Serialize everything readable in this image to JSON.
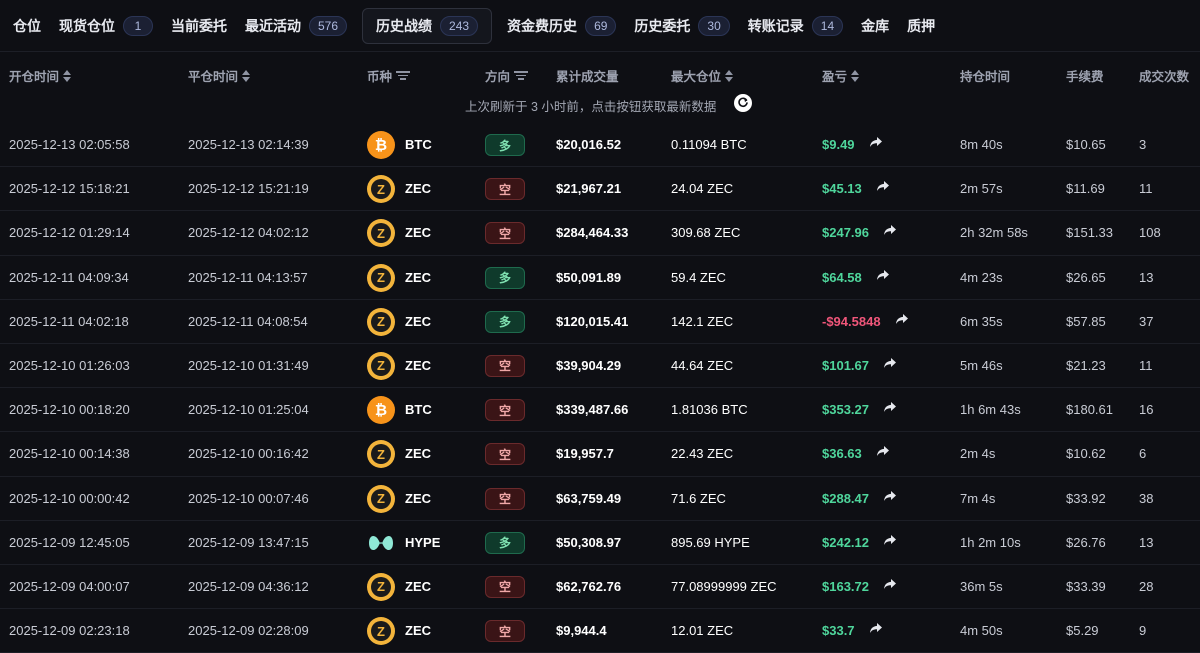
{
  "tabs": [
    {
      "label": "仓位",
      "badge": null,
      "active": false
    },
    {
      "label": "现货仓位",
      "badge": "1",
      "active": false
    },
    {
      "label": "当前委托",
      "badge": null,
      "active": false
    },
    {
      "label": "最近活动",
      "badge": "576",
      "active": false
    },
    {
      "label": "历史战绩",
      "badge": "243",
      "active": true
    },
    {
      "label": "资金费历史",
      "badge": "69",
      "active": false
    },
    {
      "label": "历史委托",
      "badge": "30",
      "active": false
    },
    {
      "label": "转账记录",
      "badge": "14",
      "active": false
    },
    {
      "label": "金库",
      "badge": null,
      "active": false
    },
    {
      "label": "质押",
      "badge": null,
      "active": false
    }
  ],
  "columns": {
    "open_time": "开仓时间",
    "close_time": "平仓时间",
    "coin": "币种",
    "direction": "方向",
    "volume": "累计成交量",
    "max_position": "最大仓位",
    "pnl": "盈亏",
    "duration": "持仓时间",
    "fee": "手续费",
    "trades": "成交次数"
  },
  "refresh_note": "上次刷新于 3 小时前，点击按钮获取最新数据",
  "colors": {
    "long": "#7fe0b0",
    "short": "#f0a8a8",
    "pnl_positive": "#4fd69c",
    "pnl_negative": "#f0567a",
    "btc": "#f7931a",
    "zec": "#f3b43b"
  },
  "rows": [
    {
      "open": "2025-12-13 02:05:58",
      "close": "2025-12-13 02:14:39",
      "coin": "BTC",
      "icon": "btc-icon",
      "dir": "多",
      "side": "long",
      "vol": "$20,016.52",
      "max": "0.11094 BTC",
      "pnl": "$9.49",
      "pnl_sign": "pos",
      "dur": "8m 40s",
      "fee": "$10.65",
      "trades": "3"
    },
    {
      "open": "2025-12-12 15:18:21",
      "close": "2025-12-12 15:21:19",
      "coin": "ZEC",
      "icon": "zec-icon",
      "dir": "空",
      "side": "short",
      "vol": "$21,967.21",
      "max": "24.04 ZEC",
      "pnl": "$45.13",
      "pnl_sign": "pos",
      "dur": "2m 57s",
      "fee": "$11.69",
      "trades": "11"
    },
    {
      "open": "2025-12-12 01:29:14",
      "close": "2025-12-12 04:02:12",
      "coin": "ZEC",
      "icon": "zec-icon",
      "dir": "空",
      "side": "short",
      "vol": "$284,464.33",
      "max": "309.68 ZEC",
      "pnl": "$247.96",
      "pnl_sign": "pos",
      "dur": "2h 32m 58s",
      "fee": "$151.33",
      "trades": "108"
    },
    {
      "open": "2025-12-11 04:09:34",
      "close": "2025-12-11 04:13:57",
      "coin": "ZEC",
      "icon": "zec-icon",
      "dir": "多",
      "side": "long",
      "vol": "$50,091.89",
      "max": "59.4 ZEC",
      "pnl": "$64.58",
      "pnl_sign": "pos",
      "dur": "4m 23s",
      "fee": "$26.65",
      "trades": "13"
    },
    {
      "open": "2025-12-11 04:02:18",
      "close": "2025-12-11 04:08:54",
      "coin": "ZEC",
      "icon": "zec-icon",
      "dir": "多",
      "side": "long",
      "vol": "$120,015.41",
      "max": "142.1 ZEC",
      "pnl": "-$94.5848",
      "pnl_sign": "neg",
      "dur": "6m 35s",
      "fee": "$57.85",
      "trades": "37"
    },
    {
      "open": "2025-12-10 01:26:03",
      "close": "2025-12-10 01:31:49",
      "coin": "ZEC",
      "icon": "zec-icon",
      "dir": "空",
      "side": "short",
      "vol": "$39,904.29",
      "max": "44.64 ZEC",
      "pnl": "$101.67",
      "pnl_sign": "pos",
      "dur": "5m 46s",
      "fee": "$21.23",
      "trades": "11"
    },
    {
      "open": "2025-12-10 00:18:20",
      "close": "2025-12-10 01:25:04",
      "coin": "BTC",
      "icon": "btc-icon",
      "dir": "空",
      "side": "short",
      "vol": "$339,487.66",
      "max": "1.81036 BTC",
      "pnl": "$353.27",
      "pnl_sign": "pos",
      "dur": "1h 6m 43s",
      "fee": "$180.61",
      "trades": "16"
    },
    {
      "open": "2025-12-10 00:14:38",
      "close": "2025-12-10 00:16:42",
      "coin": "ZEC",
      "icon": "zec-icon",
      "dir": "空",
      "side": "short",
      "vol": "$19,957.7",
      "max": "22.43 ZEC",
      "pnl": "$36.63",
      "pnl_sign": "pos",
      "dur": "2m 4s",
      "fee": "$10.62",
      "trades": "6"
    },
    {
      "open": "2025-12-10 00:00:42",
      "close": "2025-12-10 00:07:46",
      "coin": "ZEC",
      "icon": "zec-icon",
      "dir": "空",
      "side": "short",
      "vol": "$63,759.49",
      "max": "71.6 ZEC",
      "pnl": "$288.47",
      "pnl_sign": "pos",
      "dur": "7m 4s",
      "fee": "$33.92",
      "trades": "38"
    },
    {
      "open": "2025-12-09 12:45:05",
      "close": "2025-12-09 13:47:15",
      "coin": "HYPE",
      "icon": "hype-icon",
      "dir": "多",
      "side": "long",
      "vol": "$50,308.97",
      "max": "895.69 HYPE",
      "pnl": "$242.12",
      "pnl_sign": "pos",
      "dur": "1h 2m 10s",
      "fee": "$26.76",
      "trades": "13"
    },
    {
      "open": "2025-12-09 04:00:07",
      "close": "2025-12-09 04:36:12",
      "coin": "ZEC",
      "icon": "zec-icon",
      "dir": "空",
      "side": "short",
      "vol": "$62,762.76",
      "max": "77.08999999 ZEC",
      "pnl": "$163.72",
      "pnl_sign": "pos",
      "dur": "36m 5s",
      "fee": "$33.39",
      "trades": "28"
    },
    {
      "open": "2025-12-09 02:23:18",
      "close": "2025-12-09 02:28:09",
      "coin": "ZEC",
      "icon": "zec-icon",
      "dir": "空",
      "side": "short",
      "vol": "$9,944.4",
      "max": "12.01 ZEC",
      "pnl": "$33.7",
      "pnl_sign": "pos",
      "dur": "4m 50s",
      "fee": "$5.29",
      "trades": "9"
    }
  ]
}
